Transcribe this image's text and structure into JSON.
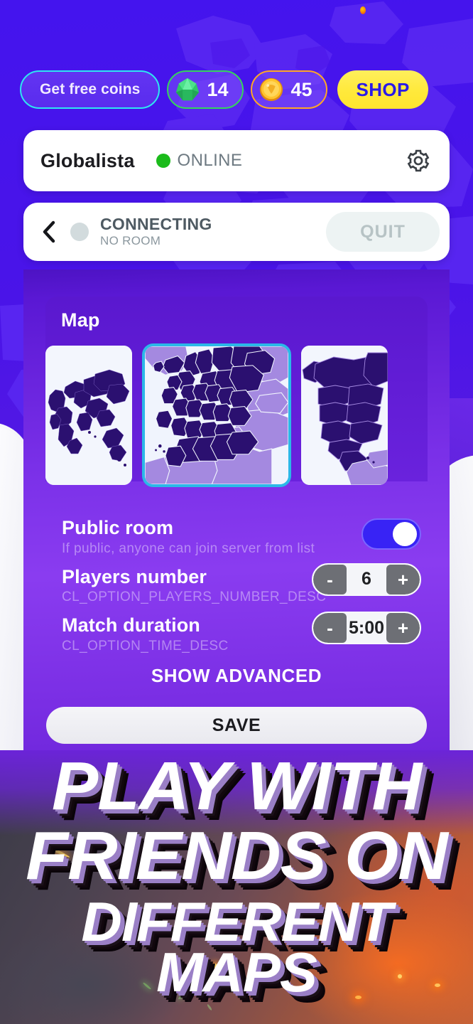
{
  "topbar": {
    "free_coins_label": "Get free coins",
    "gem_count": "14",
    "coin_count": "45",
    "shop_label": "SHOP",
    "gem_icon": "gem-icon",
    "coin_icon": "coin-icon"
  },
  "profile": {
    "name": "Globalista",
    "status": "ONLINE",
    "status_color": "#1bbb1b",
    "gear_icon": "gear-icon"
  },
  "connection": {
    "back_icon": "chevron-left-icon",
    "title": "CONNECTING",
    "subtitle": "NO ROOM",
    "quit_label": "QUIT"
  },
  "panel": {
    "map": {
      "title": "Map",
      "options": [
        {
          "name": "map-thumb-world",
          "selected": false
        },
        {
          "name": "map-thumb-europe",
          "selected": true
        },
        {
          "name": "map-thumb-north-america",
          "selected": false
        }
      ]
    },
    "settings": [
      {
        "label": "Public room",
        "desc": "If public, anyone can join server from list",
        "control": "toggle",
        "value": "on"
      },
      {
        "label": "Players number",
        "desc": "CL_OPTION_PLAYERS_NUMBER_DESC",
        "control": "stepper",
        "value": "6",
        "minus": "-",
        "plus": "+"
      },
      {
        "label": "Match duration",
        "desc": "CL_OPTION_TIME_DESC",
        "control": "stepper",
        "value": "5:00",
        "minus": "-",
        "plus": "+"
      }
    ],
    "show_advanced_label": "SHOW ADVANCED",
    "save_label": "SAVE"
  },
  "hero": {
    "line1": "PLAY WITH",
    "line2": "FRIENDS ON",
    "line3": "DIFFERENT MAPS"
  },
  "colors": {
    "background_purple": "#4a14e8",
    "panel_purple": "#8a3cf0",
    "accent_cyan": "#2bb8e8",
    "accent_yellow": "#ffe93b",
    "shop_text_blue": "#2a1ae8",
    "toggle_on": "#3823f5",
    "map_dark": "#2b1070",
    "map_light": "#a489e0",
    "online_green": "#1bbb1b"
  }
}
